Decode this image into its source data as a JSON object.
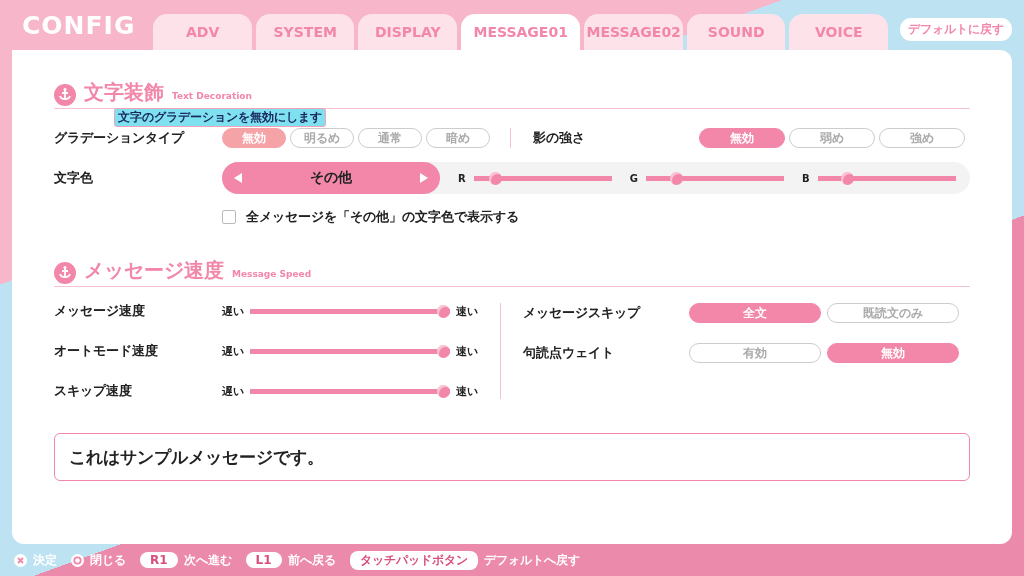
{
  "title": "CONFIG",
  "tabs": [
    {
      "label": "ADV",
      "selected": false
    },
    {
      "label": "SYSTEM",
      "selected": false
    },
    {
      "label": "DISPLAY",
      "selected": false
    },
    {
      "label": "MESSAGE01",
      "selected": true
    },
    {
      "label": "MESSAGE02",
      "selected": false
    },
    {
      "label": "SOUND",
      "selected": false
    },
    {
      "label": "VOICE",
      "selected": false
    }
  ],
  "reset_button": "デフォルトに戻す",
  "text_decoration": {
    "heading": "文字装飾",
    "subheading": "Text Decoration",
    "tooltip": "文字のグラデーションを無効にします",
    "gradation": {
      "label": "グラデーションタイプ",
      "options": [
        {
          "label": "無効",
          "selected": true
        },
        {
          "label": "明るめ",
          "selected": false
        },
        {
          "label": "通常",
          "selected": false
        },
        {
          "label": "暗め",
          "selected": false
        }
      ]
    },
    "shadow": {
      "label": "影の強さ",
      "options": [
        {
          "label": "無効",
          "selected": true
        },
        {
          "label": "弱め",
          "selected": false
        },
        {
          "label": "強め",
          "selected": false
        }
      ]
    },
    "text_color": {
      "label": "文字色",
      "value": "その他",
      "sliders": [
        {
          "label": "R",
          "level": 0.12
        },
        {
          "label": "G",
          "level": 0.19
        },
        {
          "label": "B",
          "level": 0.19
        }
      ]
    },
    "apply_all": {
      "label": "全メッセージを「その他」の文字色で表示する",
      "checked": false
    }
  },
  "message_speed": {
    "heading": "メッセージ速度",
    "subheading": "Message Speed",
    "sliders": [
      {
        "label": "メッセージ速度",
        "slow": "遅い",
        "fast": "速い",
        "level": 1
      },
      {
        "label": "オートモード速度",
        "slow": "遅い",
        "fast": "速い",
        "level": 1
      },
      {
        "label": "スキップ速度",
        "slow": "遅い",
        "fast": "速い",
        "level": 1
      }
    ],
    "toggles": [
      {
        "label": "メッセージスキップ",
        "options": [
          {
            "label": "全文",
            "selected": true
          },
          {
            "label": "既読文のみ",
            "selected": false
          }
        ]
      },
      {
        "label": "句読点ウェイト",
        "options": [
          {
            "label": "有効",
            "selected": false
          },
          {
            "label": "無効",
            "selected": true
          }
        ]
      }
    ]
  },
  "sample_message": "これはサンプルメッセージです。",
  "footer_hints": [
    {
      "kind": "cross",
      "text": "決定"
    },
    {
      "kind": "circle",
      "text": "閉じる"
    },
    {
      "kind": "key",
      "key": "R1",
      "text": "次へ進む"
    },
    {
      "kind": "key",
      "key": "L1",
      "text": "前へ戻る"
    },
    {
      "kind": "key",
      "key": "タッチパッドボタン",
      "text": "デフォルトへ戻す"
    }
  ]
}
